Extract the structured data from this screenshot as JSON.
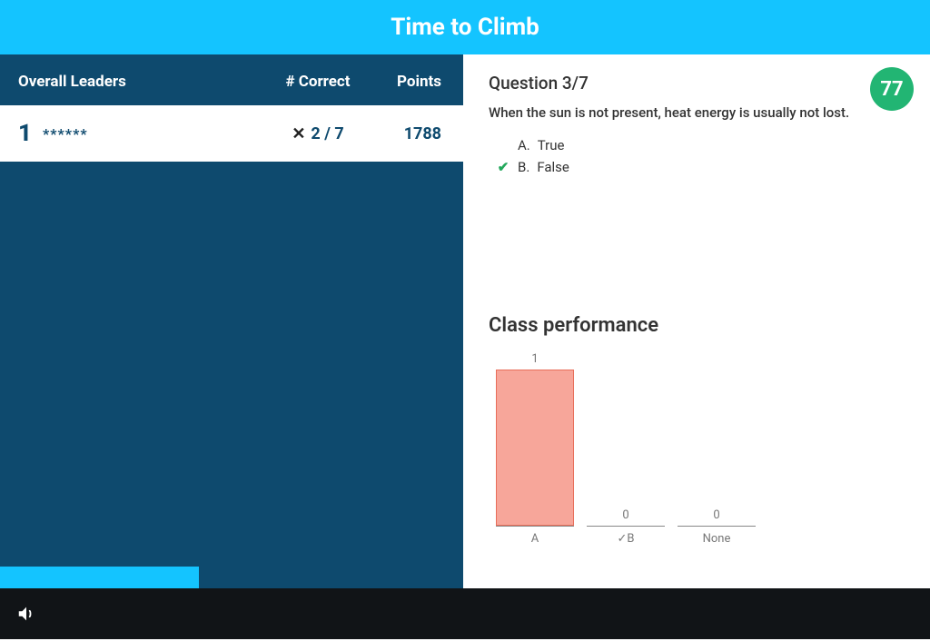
{
  "header": {
    "title": "Time to Climb"
  },
  "leaders": {
    "col_overall": "Overall Leaders",
    "col_correct": "# Correct",
    "col_points": "Points",
    "rows": [
      {
        "rank": "1",
        "name": "******",
        "correct": "2 / 7",
        "points": "1788",
        "wrong": true
      }
    ]
  },
  "progress": {
    "percent": 43
  },
  "question": {
    "label": "Question 3/7",
    "text": "When the sun is not present, heat energy is usually not lost.",
    "options": [
      {
        "letter": "A.",
        "text": "True",
        "correct": false
      },
      {
        "letter": "B.",
        "text": "False",
        "correct": true
      }
    ],
    "badge": "77"
  },
  "performance": {
    "title": "Class performance"
  },
  "chart_data": {
    "type": "bar",
    "categories": [
      "A",
      "✓B",
      "None"
    ],
    "values": [
      1,
      0,
      0
    ],
    "title": "Class performance",
    "xlabel": "",
    "ylabel": "",
    "ylim": [
      0,
      1
    ]
  },
  "icons": {
    "sound": "sound-icon"
  }
}
